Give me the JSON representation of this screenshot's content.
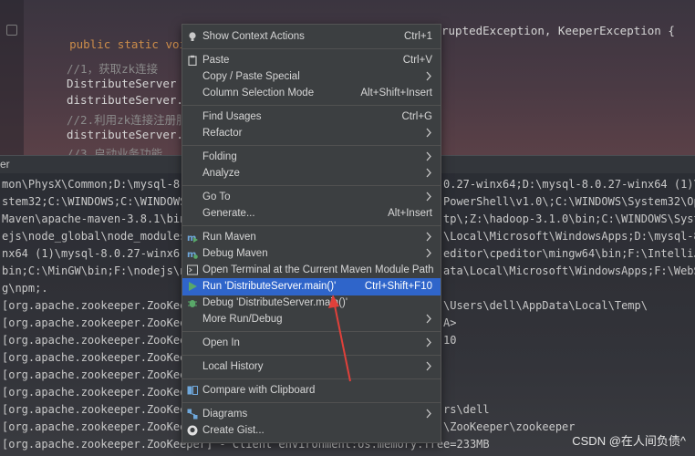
{
  "editor": {
    "signature_start": "public static void ma",
    "signature_end": "ruptedException, KeeperException {",
    "lines": [
      {
        "text": "//1，获取zk连接",
        "type": "comment"
      },
      {
        "text": "DistributeServer d",
        "type": "code"
      },
      {
        "text": "distributeServer.g",
        "type": "code"
      },
      {
        "text": "//2.利用zk连接注册服",
        "type": "comment"
      },
      {
        "text": "distributeServer.r",
        "type": "code"
      },
      {
        "text": "//3.启动业务功能",
        "type": "comment"
      }
    ]
  },
  "console": {
    "tab_label": "er",
    "lines_left": [
      "mon\\PhysX\\Common;D:\\mysql-8.0",
      "stem32;C:\\WINDOWS;C:\\WINDOWS",
      "Maven\\apache-maven-3.8.1\\bin",
      "ejs\\node_global\\node_modules",
      "nx64 (1)\\mysql-8.0.27-winx6",
      "bin;C:\\MinGW\\bin;F:\\nodejs\\n",
      "g\\npm;.",
      "[org.apache.zookeeper.ZooKee",
      "[org.apache.zookeeper.ZooKee",
      "[org.apache.zookeeper.ZooKee",
      "[org.apache.zookeeper.ZooKee",
      "[org.apache.zookeeper.ZooKee",
      "[org.apache.zookeeper.ZooKee",
      "[org.apache.zookeeper.ZooKee",
      "[org.apache.zookeeper.ZooKee",
      "[org.apache.zookeeper.ZooKeeper] - Client environment:os.memory.free=233MB"
    ],
    "lines_right": [
      "0.27-winx64;D:\\mysql-8.0.27-winx64 (1)\\",
      "PowerShell\\v1.0\\;C:\\WINDOWS\\System32\\Ope",
      "tp\\;Z:\\hadoop-3.1.0\\bin;C:\\WINDOWS\\Syste",
      "\\Local\\Microsoft\\WindowsApps;D:\\mysql-8.",
      "editor\\cpeditor\\mingw64\\bin;F:\\IntelliJ I",
      "ata\\Local\\Microsoft\\WindowsApps;F:\\WebSt",
      "",
      "\\Users\\dell\\AppData\\Local\\Temp\\",
      "A>",
      "10",
      "",
      "",
      "",
      "rs\\dell",
      "\\ZooKeeper\\zookeeper",
      ""
    ]
  },
  "menu": {
    "items": [
      {
        "label": "Show Context Actions",
        "shortcut": "Ctrl+1",
        "icon": "bulb-icon",
        "submenu": false
      },
      {
        "label": "Paste",
        "shortcut": "Ctrl+V",
        "icon": "clipboard-icon",
        "submenu": false
      },
      {
        "label": "Copy / Paste Special",
        "shortcut": "",
        "icon": "",
        "submenu": true
      },
      {
        "label": "Column Selection Mode",
        "shortcut": "Alt+Shift+Insert",
        "icon": "",
        "submenu": false
      },
      {
        "label": "Find Usages",
        "shortcut": "Ctrl+G",
        "icon": "",
        "submenu": false
      },
      {
        "label": "Refactor",
        "shortcut": "",
        "icon": "",
        "submenu": true
      },
      {
        "label": "Folding",
        "shortcut": "",
        "icon": "",
        "submenu": true
      },
      {
        "label": "Analyze",
        "shortcut": "",
        "icon": "",
        "submenu": true
      },
      {
        "label": "Go To",
        "shortcut": "",
        "icon": "",
        "submenu": true
      },
      {
        "label": "Generate...",
        "shortcut": "Alt+Insert",
        "icon": "",
        "submenu": false
      },
      {
        "label": "Run Maven",
        "shortcut": "",
        "icon": "maven-run-icon",
        "submenu": true
      },
      {
        "label": "Debug Maven",
        "shortcut": "",
        "icon": "maven-debug-icon",
        "submenu": true
      },
      {
        "label": "Open Terminal at the Current Maven Module Path",
        "shortcut": "",
        "icon": "terminal-icon",
        "submenu": false
      },
      {
        "label": "Run 'DistributeServer.main()'",
        "shortcut": "Ctrl+Shift+F10",
        "icon": "run-icon",
        "submenu": false
      },
      {
        "label": "Debug 'DistributeServer.main()'",
        "shortcut": "",
        "icon": "debug-icon",
        "submenu": false
      },
      {
        "label": "More Run/Debug",
        "shortcut": "",
        "icon": "",
        "submenu": true
      },
      {
        "label": "Open In",
        "shortcut": "",
        "icon": "",
        "submenu": true
      },
      {
        "label": "Local History",
        "shortcut": "",
        "icon": "",
        "submenu": true
      },
      {
        "label": "Compare with Clipboard",
        "shortcut": "",
        "icon": "compare-icon",
        "submenu": false
      },
      {
        "label": "Diagrams",
        "shortcut": "",
        "icon": "diagram-icon",
        "submenu": true
      },
      {
        "label": "Create Gist...",
        "shortcut": "",
        "icon": "github-icon",
        "submenu": false
      }
    ]
  },
  "watermark": "CSDN @在人间负债^",
  "colors": {
    "menu_bg": "#3c3f41",
    "selection": "#2f65ca",
    "annotation": "#e0403a"
  }
}
